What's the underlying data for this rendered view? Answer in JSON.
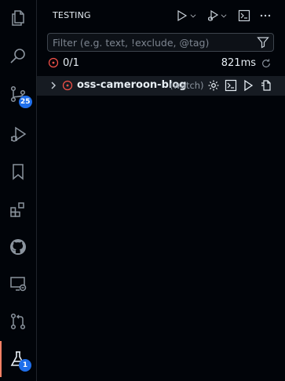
{
  "activity_bar": {
    "items": [
      {
        "name": "explorer",
        "icon": "files-icon"
      },
      {
        "name": "search",
        "icon": "search-icon"
      },
      {
        "name": "source-control",
        "icon": "source-control-icon",
        "badge": "25"
      },
      {
        "name": "run-and-debug",
        "icon": "debug-run-icon"
      },
      {
        "name": "bookmarks",
        "icon": "bookmark-icon"
      },
      {
        "name": "extensions",
        "icon": "extensions-icon"
      },
      {
        "name": "github",
        "icon": "github-icon"
      },
      {
        "name": "remote-explorer",
        "icon": "remote-explorer-icon"
      },
      {
        "name": "pull-requests",
        "icon": "pull-request-icon"
      },
      {
        "name": "testing",
        "icon": "beaker-icon",
        "badge": "1",
        "active": true
      }
    ]
  },
  "sidebar": {
    "title": "TESTING",
    "filter": {
      "placeholder": "Filter (e.g. text, !exclude, @tag)",
      "value": ""
    },
    "summary": {
      "count": "0/1",
      "duration": "821ms"
    },
    "tree": [
      {
        "label": "oss-cameroon-blog",
        "description": "(watch)",
        "status": "failed",
        "expanded": false
      }
    ]
  },
  "colors": {
    "background": "#010409",
    "accent": "#1f6feb",
    "active_indicator": "#f78166",
    "error": "#f85149",
    "icon": "#8b949e"
  }
}
